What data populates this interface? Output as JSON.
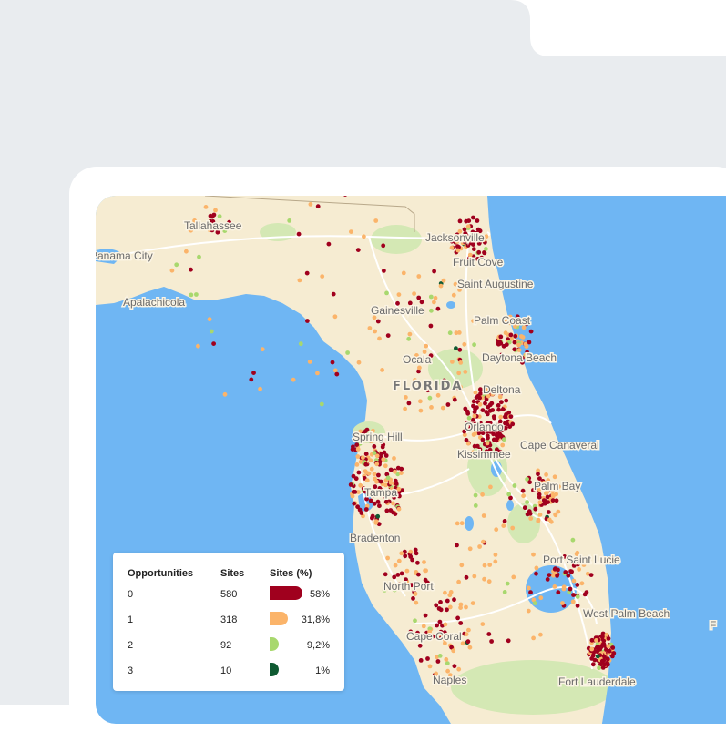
{
  "map": {
    "region_label": "FLORIDA",
    "cities": [
      {
        "name": "Tallahassee"
      },
      {
        "name": "Panama City"
      },
      {
        "name": "Apalachicola"
      },
      {
        "name": "Jacksonville"
      },
      {
        "name": "Fruit Cove"
      },
      {
        "name": "Saint Augustine"
      },
      {
        "name": "Gainesville"
      },
      {
        "name": "Palm Coast"
      },
      {
        "name": "Ocala"
      },
      {
        "name": "Daytona Beach"
      },
      {
        "name": "Deltona"
      },
      {
        "name": "Spring Hill"
      },
      {
        "name": "Orlando"
      },
      {
        "name": "Kissimmee"
      },
      {
        "name": "Cape Canaveral"
      },
      {
        "name": "Palm Bay"
      },
      {
        "name": "Tampa"
      },
      {
        "name": "Bradenton"
      },
      {
        "name": "Port Saint Lucie"
      },
      {
        "name": "North Port"
      },
      {
        "name": "West Palm Beach"
      },
      {
        "name": "Cape Coral"
      },
      {
        "name": "Naples"
      },
      {
        "name": "Fort Lauderdale"
      },
      {
        "name": "F"
      }
    ],
    "colors": {
      "water": "#6fb6f3",
      "land": "#f6ecd2",
      "park": "#d4e8b4",
      "road": "#ffffff",
      "opp0": "#a0001e",
      "opp1": "#fbb46a",
      "opp2": "#a8d86e",
      "opp3": "#0f5a32"
    }
  },
  "legend": {
    "headers": {
      "opportunities": "Opportunities",
      "sites": "Sites",
      "sites_pct": "Sites (%)"
    },
    "rows": [
      {
        "opportunities": "0",
        "sites": "580",
        "pct": "58%",
        "share": 0.58,
        "color": "#a0001e"
      },
      {
        "opportunities": "1",
        "sites": "318",
        "pct": "31,8%",
        "share": 0.318,
        "color": "#fbb46a"
      },
      {
        "opportunities": "2",
        "sites": "92",
        "pct": "9,2%",
        "share": 0.092,
        "color": "#a8d86e"
      },
      {
        "opportunities": "3",
        "sites": "10",
        "pct": "1%",
        "share": 0.01,
        "color": "#0f5a32"
      }
    ]
  }
}
